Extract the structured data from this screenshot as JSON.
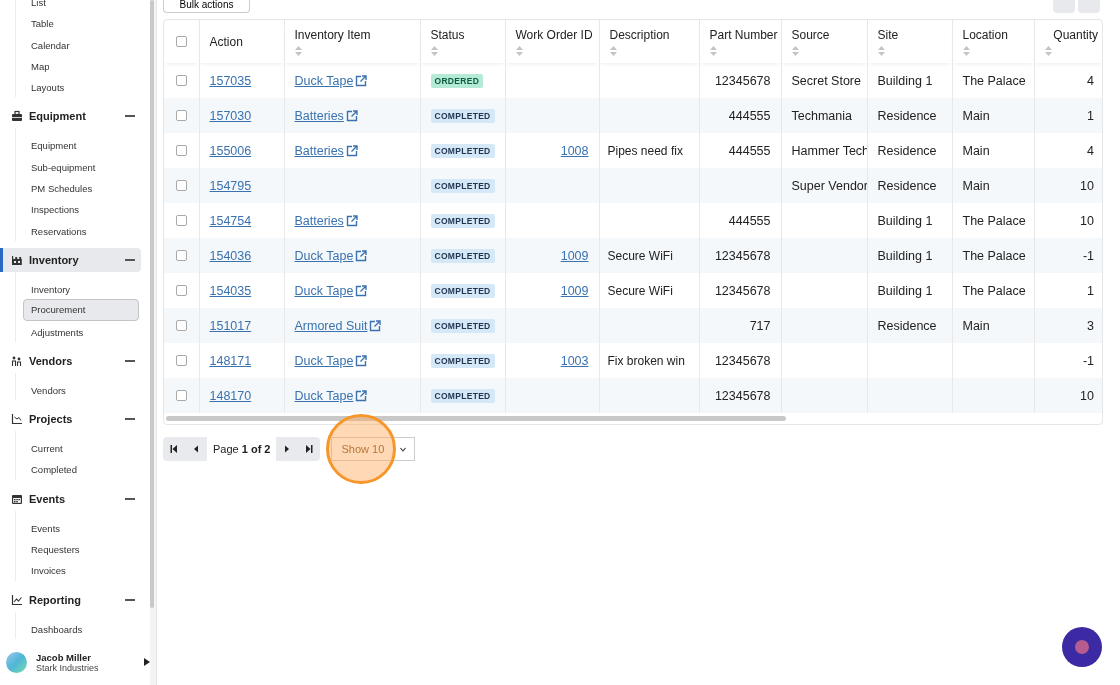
{
  "sidebar": {
    "groups": [
      {
        "items": [
          {
            "label": "List",
            "selected": false
          },
          {
            "label": "Table",
            "selected": false
          },
          {
            "label": "Calendar",
            "selected": false
          },
          {
            "label": "Map",
            "selected": false
          },
          {
            "label": "Layouts",
            "selected": false
          }
        ]
      },
      {
        "title": "Equipment",
        "expanded": true,
        "selected": false,
        "items": [
          {
            "label": "Equipment",
            "selected": false
          },
          {
            "label": "Sub-equipment",
            "selected": false
          },
          {
            "label": "PM Schedules",
            "selected": false
          },
          {
            "label": "Inspections",
            "selected": false
          },
          {
            "label": "Reservations",
            "selected": false
          }
        ]
      },
      {
        "title": "Inventory",
        "expanded": true,
        "selected": true,
        "items": [
          {
            "label": "Inventory",
            "selected": false
          },
          {
            "label": "Procurement",
            "selected": true
          },
          {
            "label": "Adjustments",
            "selected": false
          }
        ]
      },
      {
        "title": "Vendors",
        "expanded": true,
        "selected": false,
        "items": [
          {
            "label": "Vendors",
            "selected": false
          }
        ]
      },
      {
        "title": "Projects",
        "expanded": true,
        "selected": false,
        "items": [
          {
            "label": "Current",
            "selected": false
          },
          {
            "label": "Completed",
            "selected": false
          }
        ]
      },
      {
        "title": "Events",
        "expanded": true,
        "selected": false,
        "items": [
          {
            "label": "Events",
            "selected": false
          },
          {
            "label": "Requesters",
            "selected": false
          },
          {
            "label": "Invoices",
            "selected": false
          }
        ]
      },
      {
        "title": "Reporting",
        "expanded": true,
        "selected": false,
        "items": [
          {
            "label": "Dashboards",
            "selected": false
          }
        ]
      }
    ],
    "user": {
      "name": "Jacob Miller",
      "company": "Stark Industries"
    }
  },
  "toolbar": {
    "bulk_actions": "Bulk actions"
  },
  "table": {
    "all_checked": false,
    "columns": [
      {
        "label": "Action",
        "sortable": false
      },
      {
        "label": "Inventory Item",
        "sortable": true
      },
      {
        "label": "Status",
        "sortable": true
      },
      {
        "label": "Work Order ID",
        "sortable": true
      },
      {
        "label": "Description",
        "sortable": true
      },
      {
        "label": "Part Number",
        "sortable": true
      },
      {
        "label": "Source",
        "sortable": true
      },
      {
        "label": "Site",
        "sortable": true
      },
      {
        "label": "Location",
        "sortable": true
      },
      {
        "label": "Quantity",
        "sortable": true
      }
    ],
    "rows": [
      {
        "selected": false,
        "action": "157035",
        "inventory_item": "Duck Tape",
        "status": {
          "label": "ORDERED",
          "kind": "ordered"
        },
        "part_number": "12345678",
        "source": "Secret Store",
        "site": "Building 1",
        "location": "The Palace",
        "quantity": "4"
      },
      {
        "selected": false,
        "action": "157030",
        "inventory_item": "Batteries",
        "status": {
          "label": "COMPLETED",
          "kind": "completed"
        },
        "part_number": "444555",
        "source": "Techmania",
        "site": "Residence",
        "location": "Main",
        "quantity": "1"
      },
      {
        "selected": false,
        "action": "155006",
        "inventory_item": "Batteries",
        "status": {
          "label": "COMPLETED",
          "kind": "completed"
        },
        "work_order_id": "1008",
        "description": "Pipes need fix",
        "part_number": "444555",
        "source": "Hammer Tech",
        "site": "Residence",
        "location": "Main",
        "quantity": "4"
      },
      {
        "selected": false,
        "action": "154795",
        "status": {
          "label": "COMPLETED",
          "kind": "completed"
        },
        "source": "Super Vendor",
        "site": "Residence",
        "location": "Main",
        "quantity": "10"
      },
      {
        "selected": false,
        "action": "154754",
        "inventory_item": "Batteries",
        "status": {
          "label": "COMPLETED",
          "kind": "completed"
        },
        "part_number": "444555",
        "site": "Building 1",
        "location": "The Palace",
        "quantity": "10"
      },
      {
        "selected": false,
        "action": "154036",
        "inventory_item": "Duck Tape",
        "status": {
          "label": "COMPLETED",
          "kind": "completed"
        },
        "work_order_id": "1009",
        "description": "Secure WiFi",
        "part_number": "12345678",
        "site": "Building 1",
        "location": "The Palace",
        "quantity": "-1"
      },
      {
        "selected": false,
        "action": "154035",
        "inventory_item": "Duck Tape",
        "status": {
          "label": "COMPLETED",
          "kind": "completed"
        },
        "work_order_id": "1009",
        "description": "Secure WiFi",
        "part_number": "12345678",
        "site": "Building 1",
        "location": "The Palace",
        "quantity": "1"
      },
      {
        "selected": false,
        "action": "151017",
        "inventory_item": "Armored Suit",
        "status": {
          "label": "COMPLETED",
          "kind": "completed"
        },
        "part_number": "717",
        "site": "Residence",
        "location": "Main",
        "quantity": "3"
      },
      {
        "selected": false,
        "action": "148171",
        "inventory_item": "Duck Tape",
        "status": {
          "label": "COMPLETED",
          "kind": "completed"
        },
        "work_order_id": "1003",
        "description": "Fix broken win",
        "part_number": "12345678",
        "quantity": "-1"
      },
      {
        "selected": false,
        "action": "148170",
        "inventory_item": "Duck Tape",
        "status": {
          "label": "COMPLETED",
          "kind": "completed"
        },
        "part_number": "12345678",
        "quantity": "10"
      }
    ]
  },
  "pagination": {
    "page": "Page **1 of 2**",
    "page_size": "Show 10"
  }
}
